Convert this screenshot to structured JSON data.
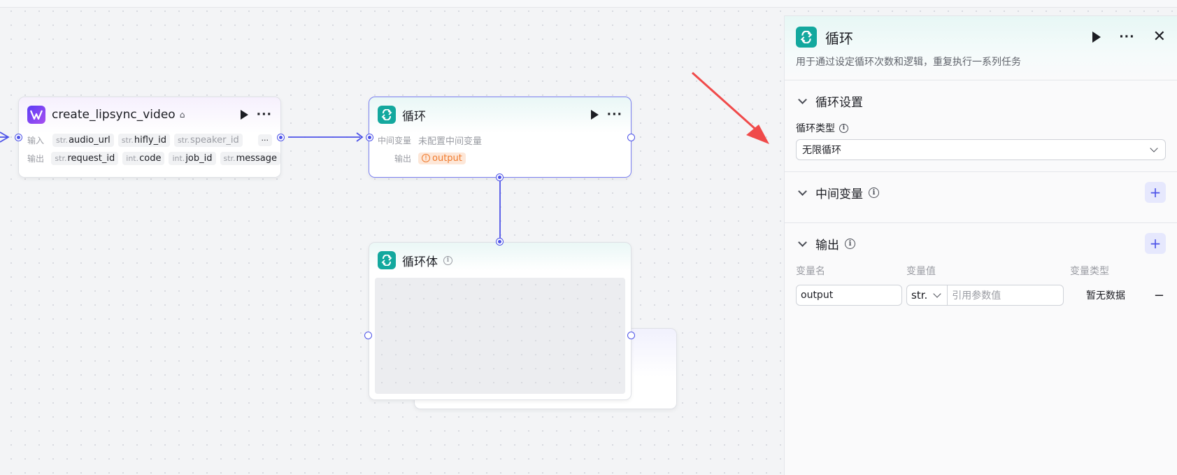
{
  "node1": {
    "title": "create_lipsync_video",
    "input_label": "输入",
    "output_label": "输出",
    "inputs": [
      {
        "type": "str.",
        "name": "audio_url"
      },
      {
        "type": "str.",
        "name": "hifly_id"
      },
      {
        "type": "str.",
        "name": "speaker_id"
      }
    ],
    "more": "···",
    "outputs": [
      {
        "type": "str.",
        "name": "request_id"
      },
      {
        "type": "int.",
        "name": "code"
      },
      {
        "type": "int.",
        "name": "job_id"
      },
      {
        "type": "str.",
        "name": "message"
      }
    ]
  },
  "node2": {
    "title": "循环",
    "var_label": "中间变量",
    "var_value": "未配置中间变量",
    "output_label": "输出",
    "output_value": "output"
  },
  "node3": {
    "title": "循环体"
  },
  "panel": {
    "title": "循环",
    "description": "用于通过设定循环次数和逻辑，重复执行一系列任务",
    "section_settings": "循环设置",
    "loop_type_label": "循环类型",
    "loop_type_value": "无限循环",
    "section_vars": "中间变量",
    "section_output": "输出",
    "col_name": "变量名",
    "col_value": "变量值",
    "col_type": "变量类型",
    "output_name": "output",
    "output_type_select": "str.",
    "output_ref_placeholder": "引用参数值",
    "output_type_value": "暂无数据",
    "remove": "−"
  },
  "icons": {
    "accent": "#4d53e8",
    "teal": "#13a89e",
    "arrow_red": "#f04a4a"
  }
}
